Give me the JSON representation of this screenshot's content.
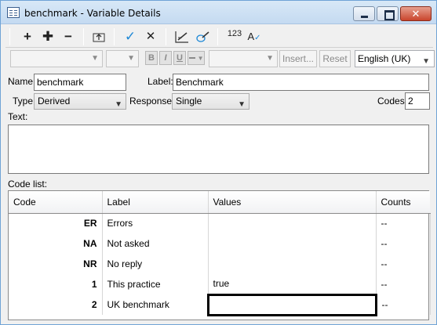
{
  "window": {
    "title": "benchmark - Variable Details",
    "close_glyph": "✕"
  },
  "toolbar": {
    "add_icon": "+",
    "add_multiple_icon": "✚",
    "remove_icon": "−",
    "check_icon": "✓",
    "cancel_icon": "✕",
    "number_label": "123",
    "spell_label": "A"
  },
  "format_toolbar": {
    "bold": "B",
    "italic": "I",
    "underline": "U",
    "insert_label": "Insert...",
    "reset_label": "Reset",
    "language": "English (UK)"
  },
  "form": {
    "name_label": "Name:",
    "name_value": "benchmark",
    "label_label": "Label:",
    "label_value": "Benchmark",
    "type_label": "Type:",
    "type_value": "Derived",
    "response_label": "Response:",
    "response_value": "Single",
    "codes_label": "Codes:",
    "codes_value": "2",
    "text_label": "Text:"
  },
  "code_list": {
    "title": "Code list:",
    "columns": [
      "Code",
      "Label",
      "Values",
      "Counts"
    ],
    "rows": [
      {
        "code": "ER",
        "label": "Errors",
        "value": "",
        "count": "--"
      },
      {
        "code": "NA",
        "label": "Not asked",
        "value": "",
        "count": "--"
      },
      {
        "code": "NR",
        "label": "No reply",
        "value": "",
        "count": "--"
      },
      {
        "code": "1",
        "label": "This practice",
        "value": "true",
        "count": "--"
      },
      {
        "code": "2",
        "label": "UK benchmark",
        "value": "",
        "count": "--"
      }
    ]
  }
}
